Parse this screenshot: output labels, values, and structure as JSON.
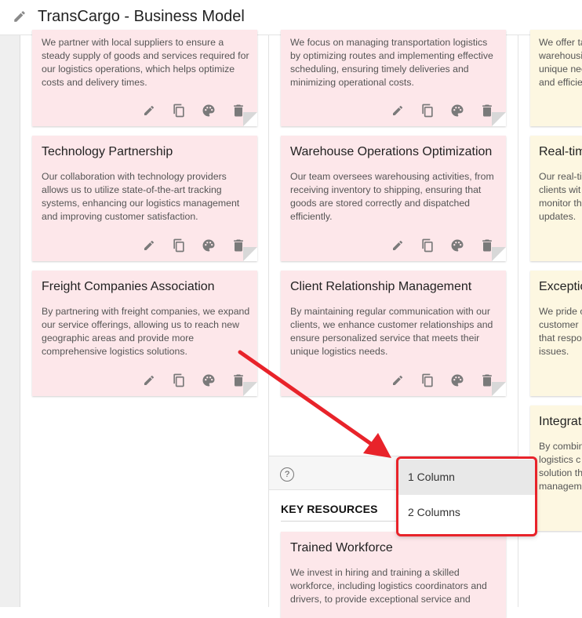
{
  "header": {
    "title": "TransCargo - Business Model"
  },
  "cards_col1": [
    {
      "title": "",
      "body": "We partner with local suppliers to ensure a steady supply of goods and services required for our logistics operations, which helps optimize costs and delivery times."
    },
    {
      "title": "Technology Partnership",
      "body": "Our collaboration with technology providers allows us to utilize state-of-the-art tracking systems, enhancing our logistics management and improving customer satisfaction."
    },
    {
      "title": "Freight Companies Association",
      "body": "By partnering with freight companies, we expand our service offerings, allowing us to reach new geographic areas and provide more comprehensive logistics solutions."
    }
  ],
  "cards_col2": [
    {
      "title": "",
      "body": "We focus on managing transportation logistics by optimizing routes and implementing effective scheduling, ensuring timely deliveries and minimizing operational costs."
    },
    {
      "title": "Warehouse Operations Optimization",
      "body": "Our team oversees warehousing activities, from receiving inventory to shipping, ensuring that goods are stored correctly and dispatched efficiently."
    },
    {
      "title": "Client Relationship Management",
      "body": "By maintaining regular communication with our clients, we enhance customer relationships and ensure personalized service that meets their unique logistics needs."
    }
  ],
  "cards_col3": [
    {
      "title": "",
      "body": "We offer ta\nwarehousi\nunique nee\nand efficie"
    },
    {
      "title": "Real-tim",
      "body": "Our real-tir\nclients wit\nmonitor th\nupdates."
    },
    {
      "title": "Exceptio",
      "body": "We pride o\ncustomer\nthat respo\nissues."
    },
    {
      "title": "Integrate",
      "body": "By combin\nlogistics c\nsolution th\nmanagem"
    }
  ],
  "key_resources": {
    "help": "?",
    "title": "KEY RESOURCES",
    "card": {
      "title": "Trained Workforce",
      "body": "We invest in hiring and training a skilled workforce, including logistics coordinators and drivers, to provide exceptional service and"
    }
  },
  "dropdown": {
    "options": [
      "1 Column",
      "2 Columns"
    ],
    "selected": "1 Column"
  },
  "colors": {
    "card_pink": "#fde7ea",
    "card_yellow": "#fdf7e1",
    "arrow_red": "#e8232a"
  },
  "icons": [
    "pencil-icon",
    "copy-icon",
    "palette-icon",
    "trash-icon",
    "help-icon"
  ]
}
